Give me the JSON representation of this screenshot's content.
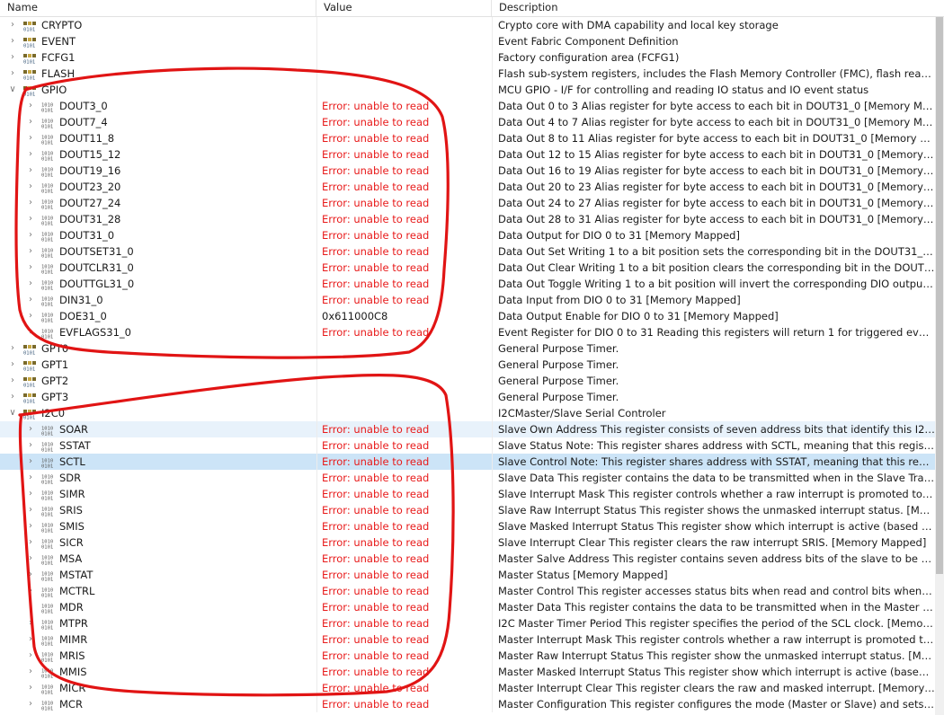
{
  "columns": {
    "name": "Name",
    "value": "Value",
    "description": "Description"
  },
  "colors": {
    "error": "#e81a1a",
    "selection": "#cce4f7",
    "annotation": "#e11414"
  },
  "rows": [
    {
      "level": 0,
      "name": "CRYPTO",
      "value": "",
      "desc": "Crypto core with DMA capability and local key storage",
      "icon": "peripheral-icon",
      "expanded": false
    },
    {
      "level": 0,
      "name": "EVENT",
      "value": "",
      "desc": "Event Fabric Component Definition",
      "icon": "peripheral-icon",
      "expanded": false
    },
    {
      "level": 0,
      "name": "FCFG1",
      "value": "",
      "desc": "Factory configuration area (FCFG1)",
      "icon": "peripheral-icon",
      "expanded": false
    },
    {
      "level": 0,
      "name": "FLASH",
      "value": "",
      "desc": "Flash sub-system registers, includes the Flash Memory Controller (FMC), flash read p...",
      "icon": "peripheral-icon",
      "expanded": false
    },
    {
      "level": 0,
      "name": "GPIO",
      "value": "",
      "desc": "MCU GPIO - I/F for controlling and reading IO status and IO event status",
      "icon": "peripheral-icon",
      "expanded": true
    },
    {
      "level": 1,
      "name": "DOUT3_0",
      "value": "Error: unable to read",
      "desc": "Data Out 0 to 3  Alias register for byte access to each bit in DOUT31_0 [Memory Mapp...",
      "icon": "register-icon"
    },
    {
      "level": 1,
      "name": "DOUT7_4",
      "value": "Error: unable to read",
      "desc": "Data Out 4 to 7  Alias register for byte access to each bit in DOUT31_0 [Memory Mapp...",
      "icon": "register-icon"
    },
    {
      "level": 1,
      "name": "DOUT11_8",
      "value": "Error: unable to read",
      "desc": "Data Out 8 to 11  Alias register for byte access to each bit in DOUT31_0 [Memory Mapp...",
      "icon": "register-icon"
    },
    {
      "level": 1,
      "name": "DOUT15_12",
      "value": "Error: unable to read",
      "desc": "Data Out 12 to 15  Alias register for byte access to each bit in DOUT31_0 [Memory Ma...",
      "icon": "register-icon"
    },
    {
      "level": 1,
      "name": "DOUT19_16",
      "value": "Error: unable to read",
      "desc": "Data Out 16 to 19  Alias register for byte access to each bit in DOUT31_0 [Memory Ma...",
      "icon": "register-icon"
    },
    {
      "level": 1,
      "name": "DOUT23_20",
      "value": "Error: unable to read",
      "desc": "Data Out 20 to 23  Alias register for byte access to each bit in DOUT31_0 [Memory Ma...",
      "icon": "register-icon"
    },
    {
      "level": 1,
      "name": "DOUT27_24",
      "value": "Error: unable to read",
      "desc": "Data Out 24 to 27  Alias register for byte access to each bit in DOUT31_0 [Memory Ma...",
      "icon": "register-icon"
    },
    {
      "level": 1,
      "name": "DOUT31_28",
      "value": "Error: unable to read",
      "desc": "Data Out 28 to 31  Alias register for byte access to each bit in DOUT31_0 [Memory Ma...",
      "icon": "register-icon"
    },
    {
      "level": 1,
      "name": "DOUT31_0",
      "value": "Error: unable to read",
      "desc": "Data Output for DIO 0 to 31 [Memory Mapped]",
      "icon": "register-icon"
    },
    {
      "level": 1,
      "name": "DOUTSET31_0",
      "value": "Error: unable to read",
      "desc": "Data Out Set  Writing 1 to a bit position sets the corresponding bit in the DOUT31_0 r...",
      "icon": "register-icon"
    },
    {
      "level": 1,
      "name": "DOUTCLR31_0",
      "value": "Error: unable to read",
      "desc": "Data Out Clear  Writing 1 to a bit position clears the corresponding bit in the DOUT31...",
      "icon": "register-icon"
    },
    {
      "level": 1,
      "name": "DOUTTGL31_0",
      "value": "Error: unable to read",
      "desc": "Data Out Toggle  Writing 1 to a bit position will invert the corresponding DIO output. ...",
      "icon": "register-icon"
    },
    {
      "level": 1,
      "name": "DIN31_0",
      "value": "Error: unable to read",
      "desc": "Data Input from DIO 0 to 31 [Memory Mapped]",
      "icon": "register-icon"
    },
    {
      "level": 1,
      "name": "DOE31_0",
      "value": "0x611000C8",
      "desc": "Data Output Enable for DIO 0 to 31 [Memory Mapped]",
      "icon": "register-icon"
    },
    {
      "level": 1,
      "name": "EVFLAGS31_0",
      "value": "Error: unable to read",
      "desc": "Event Register for DIO 0 to 31  Reading  this registers will return 1 for triggered event a...",
      "icon": "register-icon"
    },
    {
      "level": 0,
      "name": "GPT0",
      "value": "",
      "desc": "General Purpose Timer.",
      "icon": "peripheral-icon",
      "expanded": false
    },
    {
      "level": 0,
      "name": "GPT1",
      "value": "",
      "desc": "General Purpose Timer.",
      "icon": "peripheral-icon",
      "expanded": false
    },
    {
      "level": 0,
      "name": "GPT2",
      "value": "",
      "desc": "General Purpose Timer.",
      "icon": "peripheral-icon",
      "expanded": false
    },
    {
      "level": 0,
      "name": "GPT3",
      "value": "",
      "desc": "General Purpose Timer.",
      "icon": "peripheral-icon",
      "expanded": false
    },
    {
      "level": 0,
      "name": "I2C0",
      "value": "",
      "desc": "I2CMaster/Slave Serial Controler",
      "icon": "peripheral-icon",
      "expanded": true
    },
    {
      "level": 1,
      "name": "SOAR",
      "value": "Error: unable to read",
      "desc": "Slave Own Address This register consists of seven address bits that identify this I2C de...",
      "icon": "register-icon",
      "state": "hi"
    },
    {
      "level": 1,
      "name": "SSTAT",
      "value": "Error: unable to read",
      "desc": "Slave Status  Note: This register shares address with SCTL, meaning that this register f...",
      "icon": "register-icon"
    },
    {
      "level": 1,
      "name": "SCTL",
      "value": "Error: unable to read",
      "desc": "Slave Control Note: This register shares address with SSTAT, meaning that this registe...",
      "icon": "register-icon",
      "state": "sel"
    },
    {
      "level": 1,
      "name": "SDR",
      "value": "Error: unable to read",
      "desc": "Slave Data This register contains the data to be transmitted when in the Slave Transmi...",
      "icon": "register-icon"
    },
    {
      "level": 1,
      "name": "SIMR",
      "value": "Error: unable to read",
      "desc": "Slave Interrupt Mask This register controls whether a raw interrupt is promoted to a c...",
      "icon": "register-icon"
    },
    {
      "level": 1,
      "name": "SRIS",
      "value": "Error: unable to read",
      "desc": "Slave Raw Interrupt Status This register shows the unmasked interrupt status. [Memor...",
      "icon": "register-icon"
    },
    {
      "level": 1,
      "name": "SMIS",
      "value": "Error: unable to read",
      "desc": "Slave Masked Interrupt Status This register show which interrupt is active (based on r...",
      "icon": "register-icon"
    },
    {
      "level": 1,
      "name": "SICR",
      "value": "Error: unable to read",
      "desc": "Slave Interrupt Clear This register clears the raw interrupt SRIS. [Memory Mapped]",
      "icon": "register-icon"
    },
    {
      "level": 1,
      "name": "MSA",
      "value": "Error: unable to read",
      "desc": "Master Salve Address This register contains seven address bits of the slave to be acces...",
      "icon": "register-icon"
    },
    {
      "level": 1,
      "name": "MSTAT",
      "value": "Error: unable to read",
      "desc": "Master Status   [Memory Mapped]",
      "icon": "register-icon"
    },
    {
      "level": 1,
      "name": "MCTRL",
      "value": "Error: unable to read",
      "desc": "Master Control  This register accesses status bits when read and control bits when wri...",
      "icon": "register-icon"
    },
    {
      "level": 1,
      "name": "MDR",
      "value": "Error: unable to read",
      "desc": "Master Data This register contains the data to be transmitted when in the Master Tran...",
      "icon": "register-icon"
    },
    {
      "level": 1,
      "name": "MTPR",
      "value": "Error: unable to read",
      "desc": "I2C Master Timer Period This register specifies the period of the SCL clock. [Memory ...",
      "icon": "register-icon"
    },
    {
      "level": 1,
      "name": "MIMR",
      "value": "Error: unable to read",
      "desc": "Master Interrupt Mask This register controls whether a raw interrupt is promoted to a ...",
      "icon": "register-icon"
    },
    {
      "level": 1,
      "name": "MRIS",
      "value": "Error: unable to read",
      "desc": "Master Raw Interrupt Status This register show the unmasked interrupt status. [Memo...",
      "icon": "register-icon"
    },
    {
      "level": 1,
      "name": "MMIS",
      "value": "Error: unable to read",
      "desc": "Master Masked Interrupt Status This register show which interrupt is active (based on ...",
      "icon": "register-icon"
    },
    {
      "level": 1,
      "name": "MICR",
      "value": "Error: unable to read",
      "desc": "Master Interrupt Clear This register clears the raw and masked interrupt. [Memory Ma...",
      "icon": "register-icon"
    },
    {
      "level": 1,
      "name": "MCR",
      "value": "Error: unable to read",
      "desc": "Master Configuration This register configures the mode (Master or Slave) and sets th...",
      "icon": "register-icon"
    }
  ]
}
